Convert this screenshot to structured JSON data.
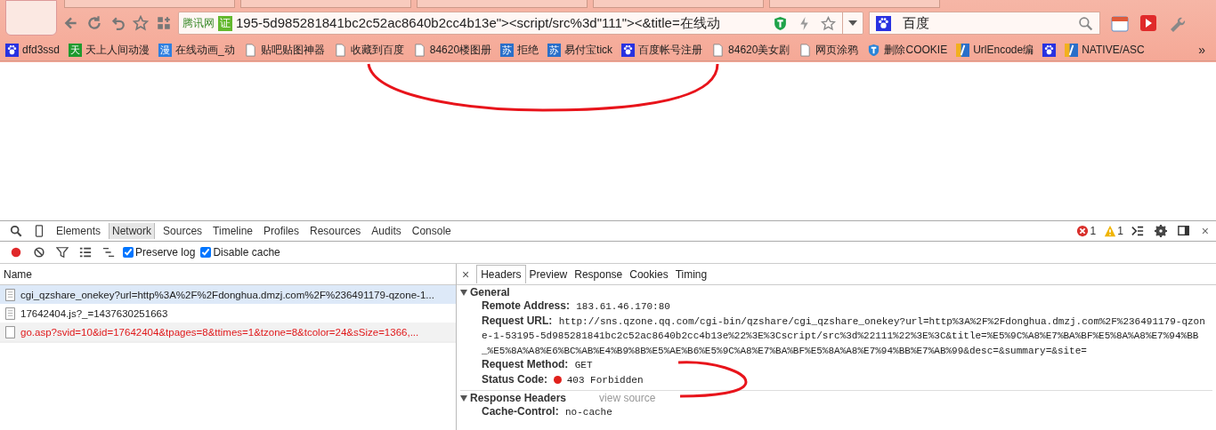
{
  "address_bar": {
    "site_badge": "腾讯网",
    "cert_mark": "证",
    "url": "195-5d985281841bc2c52ac8640b2cc4b13e\"><script/src%3d\"111\"><&title=在线动"
  },
  "search_box": {
    "value": "百度"
  },
  "bookmarks": [
    {
      "label": "dfd3ssd",
      "kind": "paw"
    },
    {
      "label": "天上人间动漫",
      "kind": "glyph",
      "glyph": "天",
      "color": "#1f9a2e"
    },
    {
      "label": "在线动画_动",
      "kind": "glyph",
      "glyph": "漫",
      "color": "#2f7fe0"
    },
    {
      "label": "贴吧贴图神器",
      "kind": "page"
    },
    {
      "label": "收藏到百度",
      "kind": "page"
    },
    {
      "label": "84620楼图册",
      "kind": "page"
    },
    {
      "label": "拒绝",
      "kind": "glyph",
      "glyph": "苏",
      "color": "#2a6fc9"
    },
    {
      "label": "易付宝tick",
      "kind": "glyph",
      "glyph": "苏",
      "color": "#2a6fc9"
    },
    {
      "label": "百度帐号注册",
      "kind": "paw"
    },
    {
      "label": "84620美女剧",
      "kind": "page"
    },
    {
      "label": "网页涂鸦",
      "kind": "page"
    },
    {
      "label": "删除COOKIE",
      "kind": "shield"
    },
    {
      "label": "UrlEncode编",
      "kind": "split"
    },
    {
      "kind": "paw"
    },
    {
      "label": "NATIVE/ASC",
      "kind": "split"
    }
  ],
  "bookmarks_more": "»",
  "devtools": {
    "panels": [
      {
        "label": "Elements",
        "selected": false
      },
      {
        "label": "Network",
        "selected": true
      },
      {
        "label": "Sources",
        "selected": false
      },
      {
        "label": "Timeline",
        "selected": false
      },
      {
        "label": "Profiles",
        "selected": false
      },
      {
        "label": "Resources",
        "selected": false
      },
      {
        "label": "Audits",
        "selected": false
      },
      {
        "label": "Console",
        "selected": false
      }
    ],
    "error_count": "1",
    "warning_count": "1",
    "close": "×",
    "recording": true,
    "preserve_log": {
      "label": "Preserve log",
      "checked": true
    },
    "disable_cache": {
      "label": "Disable cache",
      "checked": true
    },
    "name_header": "Name",
    "requests": [
      {
        "name": "cgi_qzshare_onekey?url=http%3A%2F%2Fdonghua.dmzj.com%2F%236491179-qzone-1...",
        "selected": true,
        "failed": false
      },
      {
        "name": "17642404.js?_=1437630251663",
        "selected": false,
        "failed": false
      },
      {
        "name": "go.asp?svid=10&id=17642404&tpages=8&ttimes=1&tzone=8&tcolor=24&sSize=1366,...",
        "selected": false,
        "failed": true
      }
    ],
    "detail_close": "×",
    "detail_tabs": [
      {
        "label": "Headers",
        "selected": true
      },
      {
        "label": "Preview",
        "selected": false
      },
      {
        "label": "Response",
        "selected": false
      },
      {
        "label": "Cookies",
        "selected": false
      },
      {
        "label": "Timing",
        "selected": false
      }
    ],
    "general": {
      "title": "General",
      "expanded": true,
      "rows": [
        {
          "key": "Remote Address:",
          "value": "183.61.46.170:80"
        },
        {
          "key": "Request URL:",
          "value": "http://sns.qzone.qq.com/cgi-bin/qzshare/cgi_qzshare_onekey?url=http%3A%2F%2Fdonghua.dmzj.com%2F%236491179-qzone-1-53195-5d985281841bc2c52ac8640b2cc4b13e%22%3E%3Cscript/src%3d%22111%22%3E%3C&title=%E5%9C%A8%E7%BA%BF%E5%8A%A8%E7%94%BB_%E5%8A%A8%E6%BC%AB%E4%B9%8B%E5%AE%B6%E5%9C%A8%E7%BA%BF%E5%8A%A8%E7%94%BB%E7%AB%99&desc=&summary=&site="
        },
        {
          "key": "Request Method:",
          "value": "GET"
        },
        {
          "key": "Status Code:",
          "value": "403 Forbidden",
          "status_ok": false
        }
      ]
    },
    "response_headers": {
      "title": "Response Headers",
      "expanded": true,
      "link": "view source",
      "rows": [
        {
          "key": "Cache-Control:",
          "value": "no-cache"
        }
      ]
    }
  }
}
